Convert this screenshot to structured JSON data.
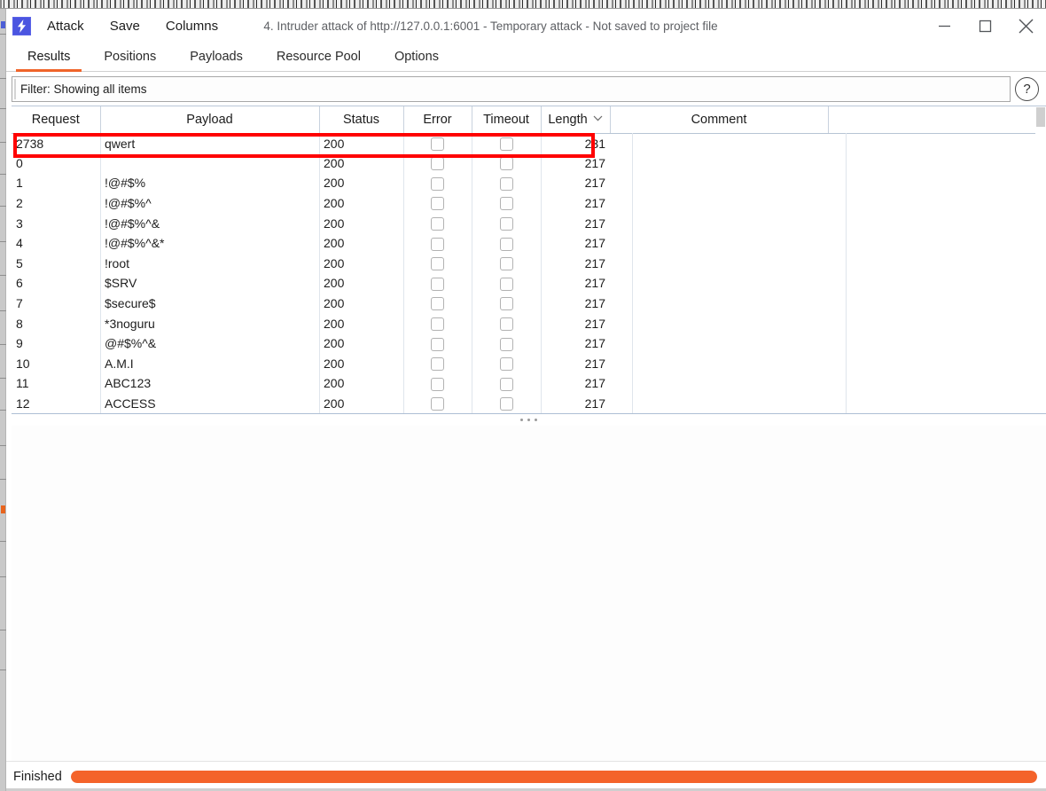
{
  "titlebar": {
    "logo_icon": "burp-lightning-icon",
    "menus": [
      {
        "label": "Attack"
      },
      {
        "label": "Save"
      },
      {
        "label": "Columns"
      }
    ],
    "title": "4. Intruder attack of http://127.0.0.1:6001 - Temporary attack - Not saved to project file",
    "minimize_icon": "minimize-icon",
    "maximize_icon": "maximize-icon",
    "close_icon": "close-icon"
  },
  "tabs": [
    {
      "label": "Results",
      "active": true
    },
    {
      "label": "Positions",
      "active": false
    },
    {
      "label": "Payloads",
      "active": false
    },
    {
      "label": "Resource Pool",
      "active": false
    },
    {
      "label": "Options",
      "active": false
    }
  ],
  "filter": {
    "value": "Filter: Showing all items",
    "placeholder": "Filter: Showing all items",
    "help_icon": "question-mark-icon",
    "help_label": "?"
  },
  "table": {
    "columns": [
      {
        "key": "request",
        "label": "Request",
        "sorted": false
      },
      {
        "key": "payload",
        "label": "Payload",
        "sorted": false
      },
      {
        "key": "status",
        "label": "Status",
        "sorted": false
      },
      {
        "key": "error",
        "label": "Error",
        "sorted": false
      },
      {
        "key": "timeout",
        "label": "Timeout",
        "sorted": false
      },
      {
        "key": "length",
        "label": "Length",
        "sorted": true,
        "sort_caret": "⌄"
      },
      {
        "key": "comment",
        "label": "Comment",
        "sorted": false
      },
      {
        "key": "spare",
        "label": "",
        "sorted": false
      }
    ],
    "highlighted_row_index": 0,
    "highlight_color": "#ff0000",
    "rows": [
      {
        "request": "2738",
        "payload": "qwert",
        "status": "200",
        "error": false,
        "timeout": false,
        "length": "231",
        "comment": ""
      },
      {
        "request": "0",
        "payload": "",
        "status": "200",
        "error": false,
        "timeout": false,
        "length": "217",
        "comment": ""
      },
      {
        "request": "1",
        "payload": "!@#$%",
        "status": "200",
        "error": false,
        "timeout": false,
        "length": "217",
        "comment": ""
      },
      {
        "request": "2",
        "payload": "!@#$%^",
        "status": "200",
        "error": false,
        "timeout": false,
        "length": "217",
        "comment": ""
      },
      {
        "request": "3",
        "payload": "!@#$%^&",
        "status": "200",
        "error": false,
        "timeout": false,
        "length": "217",
        "comment": ""
      },
      {
        "request": "4",
        "payload": "!@#$%^&*",
        "status": "200",
        "error": false,
        "timeout": false,
        "length": "217",
        "comment": ""
      },
      {
        "request": "5",
        "payload": "!root",
        "status": "200",
        "error": false,
        "timeout": false,
        "length": "217",
        "comment": ""
      },
      {
        "request": "6",
        "payload": "$SRV",
        "status": "200",
        "error": false,
        "timeout": false,
        "length": "217",
        "comment": ""
      },
      {
        "request": "7",
        "payload": "$secure$",
        "status": "200",
        "error": false,
        "timeout": false,
        "length": "217",
        "comment": ""
      },
      {
        "request": "8",
        "payload": "*3noguru",
        "status": "200",
        "error": false,
        "timeout": false,
        "length": "217",
        "comment": ""
      },
      {
        "request": "9",
        "payload": "@#$%^&",
        "status": "200",
        "error": false,
        "timeout": false,
        "length": "217",
        "comment": ""
      },
      {
        "request": "10",
        "payload": "A.M.I",
        "status": "200",
        "error": false,
        "timeout": false,
        "length": "217",
        "comment": ""
      },
      {
        "request": "11",
        "payload": "ABC123",
        "status": "200",
        "error": false,
        "timeout": false,
        "length": "217",
        "comment": ""
      },
      {
        "request": "12",
        "payload": "ACCESS",
        "status": "200",
        "error": false,
        "timeout": false,
        "length": "217",
        "comment": ""
      }
    ]
  },
  "splitter": {
    "handle_icon": "drag-dots-icon"
  },
  "statusbar": {
    "status": "Finished",
    "progress_percent": 100,
    "progress_color": "#f4632a"
  }
}
